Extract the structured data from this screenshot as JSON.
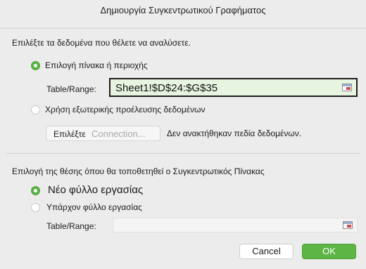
{
  "dialog": {
    "title": "Δημιουργία Συγκεντρωτικού Γραφήματος"
  },
  "data_section": {
    "prompt": "Επιλέξτε τα δεδομένα που θέλετε να αναλύσετε.",
    "option_table": {
      "label": "Επιλογή πίνακα ή περιοχής",
      "selected": true
    },
    "table_range_label": "Table/Range:",
    "table_range_value": "Sheet1!$D$24:$G$35",
    "option_external": {
      "label": "Χρήση εξωτερικής προέλευσης δεδομένων",
      "selected": false
    },
    "connection_button": {
      "label_prefix": "Επιλέξτε",
      "label_suffix": "Connection..."
    },
    "no_fields_text": "Δεν ανακτήθηκαν πεδία δεδομένων."
  },
  "placement_section": {
    "prompt": "Επιλογή της θέσης όπου θα τοποθετηθεί ο Συγκεντρωτικός Πίνακας",
    "option_new_sheet": {
      "label": "Νέο φύλλο εργασίας",
      "selected": true
    },
    "option_existing_sheet": {
      "label": "Υπάρχον φύλλο εργασίας",
      "selected": false
    },
    "table_range_label": "Table/Range:",
    "table_range_value": ""
  },
  "buttons": {
    "cancel": "Cancel",
    "ok": "OK"
  },
  "colors": {
    "accent_green": "#5cb545",
    "active_field_bg": "#e7f4e0",
    "dialog_bg": "#ececec"
  },
  "icons": {
    "range_picker": "range-select-icon"
  }
}
